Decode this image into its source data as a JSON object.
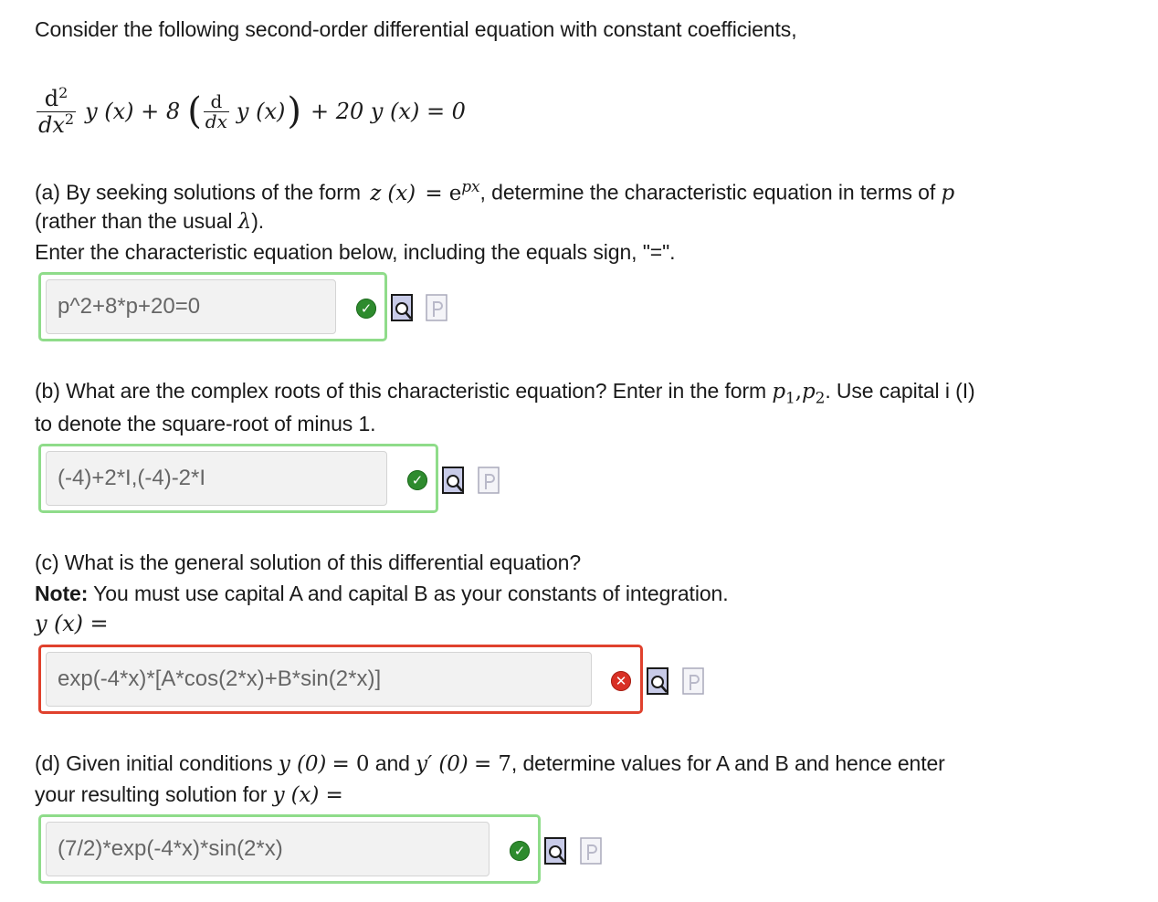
{
  "intro": "Consider the following second-order differential equation with constant coefficients,",
  "equation": {
    "d2": "d",
    "sup2": "2",
    "dx2": "dx",
    "sup2b": "2",
    "yx1": "y (x) + 8",
    "d": "d",
    "dx": "dx",
    "yx2": "y (x)",
    "tail": "+ 20 y (x) = 0"
  },
  "part_a": {
    "line1_pre": "(a) By seeking solutions of the form",
    "zx": "z (x)",
    "eq": "= e",
    "px": "px",
    "line1_post": ", determine the characteristic equation in terms of",
    "p": "p",
    "line2_pre": "(rather than the usual",
    "lambda": "λ",
    "line2_post": ").",
    "line3": "Enter the characteristic equation below, including the equals sign, \"=\".",
    "answer": "p^2+8*p+20=0"
  },
  "part_b": {
    "line1_pre": "(b) What are the complex roots of this characteristic equation? Enter in the form",
    "p1": "p",
    "sub1": "1",
    "comma": ",",
    "p2": "p",
    "sub2": "2",
    "line1_post": ". Use capital i (I)",
    "line2": "to denote the square-root of minus 1.",
    "answer": "(-4)+2*I,(-4)-2*I"
  },
  "part_c": {
    "line1": "(c) What is the general solution of this differential equation?",
    "note_bold": "Note:",
    "note_rest": "You must use capital A and capital B as your constants of integration.",
    "yx": "y (x) =",
    "answer": "exp(-4*x)*[A*cos(2*x)+B*sin(2*x)]"
  },
  "part_d": {
    "line1_pre": "(d) Given initial conditions",
    "y0": "y (0)",
    "eq0": "= 0",
    "and": "and",
    "yp0": "y′ (0)",
    "eq7": "= 7",
    "line1_post": ", determine values for A and B and hence enter",
    "line2_pre": "your resulting solution for",
    "yx": "y (x) =",
    "answer": "(7/2)*exp(-4*x)*sin(2*x)"
  },
  "status_marks": {
    "correct": "✓",
    "incorrect": "✕"
  },
  "colors": {
    "correct_border": "#8fdc8a",
    "incorrect_border": "#e0412d",
    "correct_mark": "#2e8b2e",
    "incorrect_mark": "#d93025"
  },
  "icons": [
    "preview-icon",
    "formula-editor-icon"
  ]
}
